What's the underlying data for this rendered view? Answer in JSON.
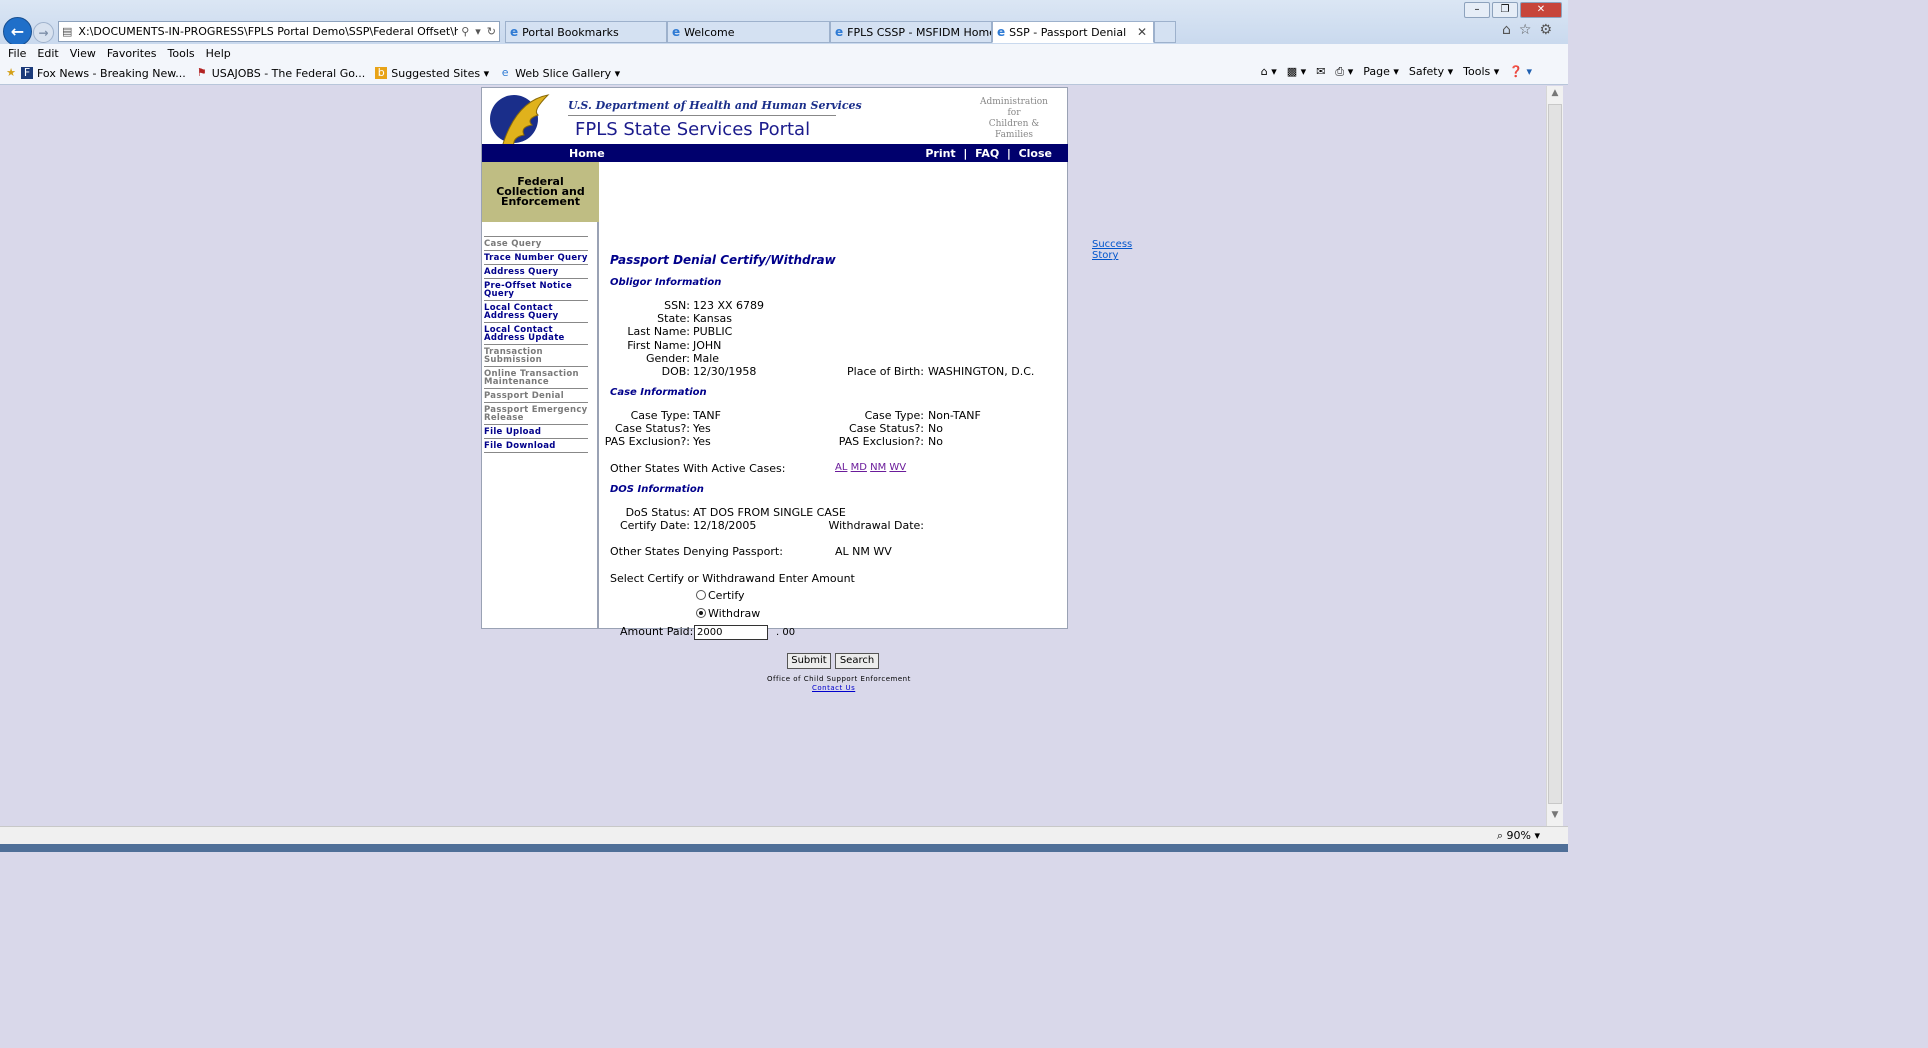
{
  "browser": {
    "address": "X:\\DOCUMENTS-IN-PROGRESS\\FPLS Portal Demo\\SSP\\Federal Offset\\html\\passportden",
    "tabs": [
      {
        "label": "Portal Bookmarks"
      },
      {
        "label": "Welcome"
      },
      {
        "label": "FPLS CSSP - MSFIDM Home P..."
      },
      {
        "label": "SSP - Passport Denial"
      }
    ],
    "menu": [
      "File",
      "Edit",
      "View",
      "Favorites",
      "Tools",
      "Help"
    ],
    "favorites": [
      "Fox News - Breaking New...",
      "USAJOBS - The Federal Go...",
      "Suggested Sites",
      "Web Slice Gallery"
    ],
    "commands": [
      "Page",
      "Safety",
      "Tools"
    ],
    "zoom": "90%"
  },
  "portal": {
    "dept": "U.S. Department of Health and Human Services",
    "title": "FPLS State Services Portal",
    "acf": [
      "Administration",
      "for",
      "Children & Families"
    ],
    "nav": {
      "home": "Home",
      "print": "Print",
      "faq": "FAQ",
      "close": "Close",
      "sep": "|"
    },
    "sidebar_title": "Federal Collection and Enforcement",
    "sidebar": [
      {
        "label": "Case Query",
        "active": false
      },
      {
        "label": "Trace Number Query",
        "active": true
      },
      {
        "label": "Address Query",
        "active": true
      },
      {
        "label": "Pre-Offset Notice Query",
        "active": true
      },
      {
        "label": "Local Contact Address Query",
        "active": true
      },
      {
        "label": "Local Contact Address Update",
        "active": true
      },
      {
        "label": "Transaction Submission",
        "active": false
      },
      {
        "label": "Online Transaction Maintenance",
        "active": false
      },
      {
        "label": "Passport Denial",
        "active": false
      },
      {
        "label": "Passport Emergency Release",
        "active": false
      },
      {
        "label": "File Upload",
        "active": true
      },
      {
        "label": "File Download",
        "active": true
      }
    ],
    "success_story": "Success Story",
    "heading": "Passport Denial Certify/Withdraw",
    "obligor": {
      "heading": "Obligor Information",
      "ssn_label": "SSN:",
      "ssn": "123 XX 6789",
      "state_label": "State:",
      "state": "Kansas",
      "last_label": "Last Name:",
      "last": "PUBLIC",
      "first_label": "First Name:",
      "first": "JOHN",
      "gender_label": "Gender:",
      "gender": "Male",
      "dob_label": "DOB:",
      "dob": "12/30/1958",
      "pob_label": "Place of Birth:",
      "pob": "WASHINGTON, D.C."
    },
    "case": {
      "heading": "Case Information",
      "type_label": "Case Type:",
      "type_left": "TANF",
      "type_right": "Non-TANF",
      "status_label": "Case Status?:",
      "status_left": "Yes",
      "status_right": "No",
      "pas_left_label": "PAS Exclusion?:",
      "pas_left": "Yes",
      "pas_right_label": "PAS Exclusion?:",
      "pas_right": "No",
      "other_label": "Other States With Active Cases:",
      "other_states": [
        "AL",
        "MD",
        "NM",
        "WV"
      ]
    },
    "dos": {
      "heading": "DOS Information",
      "status_label": "DoS Status:",
      "status": "AT DOS FROM SINGLE CASE",
      "certify_label": "Certify Date:",
      "certify": "12/18/2005",
      "withdraw_label": "Withdrawal Date:",
      "withdraw": "",
      "denying_label": "Other States Denying Passport:",
      "denying": "AL NM WV"
    },
    "form": {
      "prompt": "Select Certify or Withdrawand Enter Amount",
      "certify": "Certify",
      "withdraw": "Withdraw",
      "selected": "Withdraw",
      "amount_label": "Amount Paid: $",
      "amount": "2000",
      "cents": ". 00",
      "submit": "Submit",
      "search": "Search"
    },
    "footer": {
      "office": "Office of Child Support Enforcement",
      "contact": "Contact Us"
    }
  }
}
